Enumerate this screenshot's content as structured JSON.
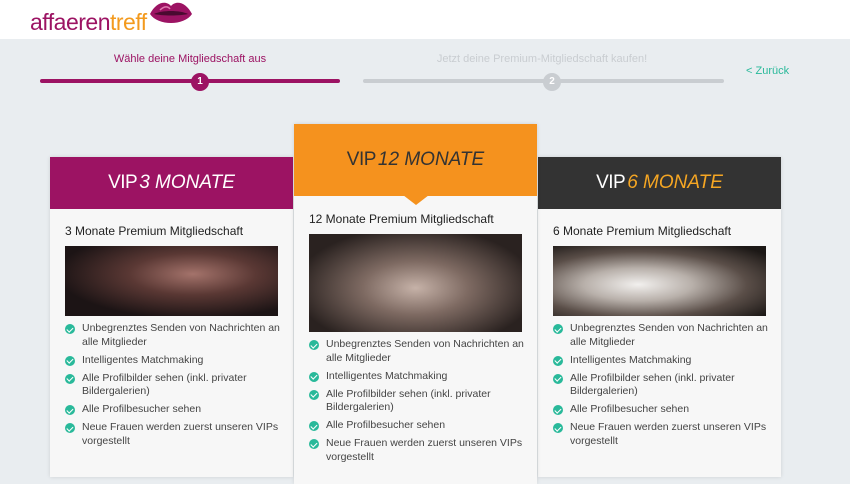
{
  "brand": {
    "part1": "affaeren",
    "part2": "treff"
  },
  "steps": [
    {
      "number": "1",
      "label": "Wähle deine Mitgliedschaft aus",
      "active": true
    },
    {
      "number": "2",
      "label": "Jetzt deine Premium-Mitgliedschaft kaufen!",
      "active": false
    }
  ],
  "back_label": "< Zurück",
  "plans": [
    {
      "vip": "VIP",
      "duration": "3 MONATE",
      "subtitle": "3 Monate Premium Mitgliedschaft",
      "features": [
        "Unbegrenztes Senden von Nachrichten an alle Mitglieder",
        "Intelligentes Matchmaking",
        "Alle Profilbilder sehen (inkl. privater Bildergalerien)",
        "Alle Profilbesucher sehen",
        "Neue Frauen werden zuerst unseren VIPs vorgestellt"
      ]
    },
    {
      "vip": "VIP",
      "duration": "12 MONATE",
      "subtitle": "12 Monate Premium Mitgliedschaft",
      "features": [
        "Unbegrenztes Senden von Nachrichten an alle Mitglieder",
        "Intelligentes Matchmaking",
        "Alle Profilbilder sehen (inkl. privater Bildergalerien)",
        "Alle Profilbesucher sehen",
        "Neue Frauen werden zuerst unseren VIPs vorgestellt"
      ]
    },
    {
      "vip": "VIP",
      "duration": "6 MONATE",
      "subtitle": "6 Monate Premium Mitgliedschaft",
      "features": [
        "Unbegrenztes Senden von Nachrichten an alle Mitglieder",
        "Intelligentes Matchmaking",
        "Alle Profilbilder sehen (inkl. privater Bildergalerien)",
        "Alle Profilbesucher sehen",
        "Neue Frauen werden zuerst unseren VIPs vorgestellt"
      ]
    }
  ],
  "colors": {
    "brand_purple": "#9c1363",
    "brand_orange": "#f5921e",
    "dark": "#333333",
    "check_green": "#29b99a"
  },
  "icons": {
    "feature": "check-circle-icon",
    "logo_mark": "lips-icon"
  }
}
